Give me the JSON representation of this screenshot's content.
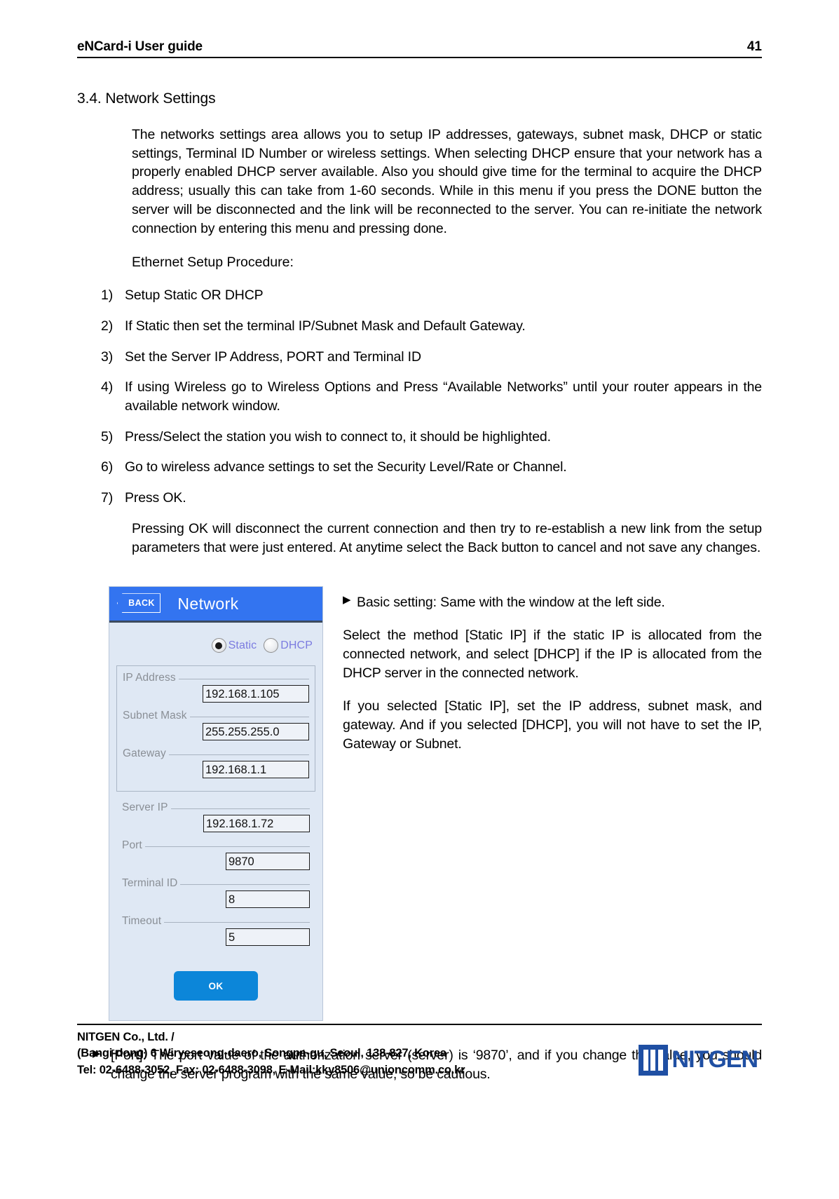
{
  "header": {
    "doc_title": "eNCard-i User guide",
    "page_number": "41"
  },
  "section": {
    "heading": "3.4. Network Settings",
    "intro": "The networks settings area allows you to setup IP addresses, gateways, subnet mask, DHCP or static settings, Terminal ID Number or wireless settings. When selecting DHCP ensure that your network has a properly enabled DHCP server available. Also you should give time for the terminal to acquire the DHCP address; usually this can take from 1-60 seconds. While in this menu if you press the DONE button the server will be disconnected and the link will be reconnected to the server. You can re-initiate the network connection by entering this menu and pressing done.",
    "procedure_label": "Ethernet Setup Procedure:",
    "steps": [
      {
        "num": "1)",
        "text": "Setup Static OR DHCP"
      },
      {
        "num": "2)",
        "text": "If Static then set the terminal IP/Subnet Mask and Default Gateway."
      },
      {
        "num": "3)",
        "text": "Set the Server IP Address, PORT and Terminal ID"
      },
      {
        "num": "4)",
        "text": "If using Wireless go to Wireless Options and Press “Available Networks” until your router appears in the available network window."
      },
      {
        "num": "5)",
        "text": "Press/Select the station you wish to connect to, it should be highlighted."
      },
      {
        "num": "6)",
        "text": "Go to wireless advance settings to set the Security Level/Rate or Channel."
      },
      {
        "num": "7)",
        "text": "Press OK."
      }
    ],
    "closing": "Pressing OK will disconnect the current connection and then try to re-establish a new link from the setup parameters that were just entered. At anytime select the Back button to cancel and not save any changes."
  },
  "device": {
    "back_label": "BACK",
    "title": "Network",
    "mode_options": [
      {
        "label": "Static",
        "selected": true
      },
      {
        "label": "DHCP",
        "selected": false
      }
    ],
    "fields": [
      {
        "label": "IP Address",
        "value": "192.168.1.105",
        "group": "static"
      },
      {
        "label": "Subnet Mask",
        "value": "255.255.255.0",
        "group": "static"
      },
      {
        "label": "Gateway",
        "value": "192.168.1.1",
        "group": "static"
      },
      {
        "label": "Server IP",
        "value": "192.168.1.72",
        "group": "server"
      },
      {
        "label": "Port",
        "value": "9870",
        "group": "server"
      },
      {
        "label": "Terminal ID",
        "value": "8",
        "group": "server"
      },
      {
        "label": "Timeout",
        "value": "5",
        "group": "server"
      }
    ],
    "ok_label": "OK",
    "colors": {
      "titlebar": "#3374f0",
      "body": "#dfe8f4",
      "ok_button": "#0c86d9",
      "radio_label": "#7b7be0"
    }
  },
  "figure_notes": [
    {
      "marker": "▶",
      "text": "Basic setting: Same with the window at the left side."
    },
    {
      "marker": "",
      "text": "Select the method [Static IP] if the static IP is allocated from the connected network, and select [DHCP] if the IP is allocated from the DHCP server in the connected network."
    },
    {
      "marker": "",
      "text": "If you selected [Static IP], set the IP address, subnet mask, and gateway.  And if you selected [DHCP], you will not have to set the IP, Gateway or Subnet."
    }
  ],
  "bottom_note": {
    "marker": "▶",
    "text": "[Port]: The port value of the authorization server (server) is ‘9870’, and if you change the value, you should change the server program with the same value, so be cautious."
  },
  "footer": {
    "line1": "NITGEN Co., Ltd. /",
    "line2": "(Bangi-dong) 6 Wiryeseong-daero, Songpa-gu, Seoul, 138-827, Korea",
    "line3": "Tel: 02-6488-3052, Fax: 02-6488-3098, E-Mail:kky8506@unioncomm.co.kr",
    "logo_text": "NITGEN"
  }
}
